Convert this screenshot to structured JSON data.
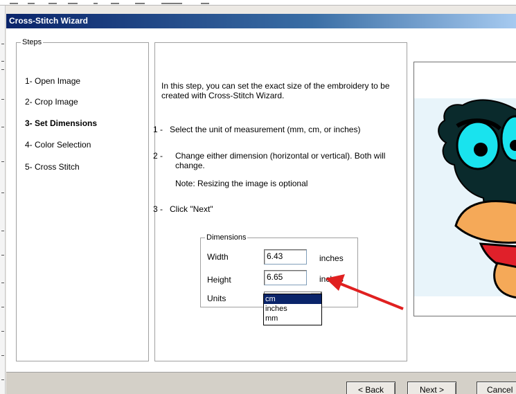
{
  "window": {
    "title": "Cross-Stitch Wizard"
  },
  "steps": {
    "label": "Steps",
    "items": [
      {
        "label": "1- Open Image",
        "active": false
      },
      {
        "label": "2- Crop Image",
        "active": false
      },
      {
        "label": "3- Set Dimensions",
        "active": true
      },
      {
        "label": "4- Color Selection",
        "active": false
      },
      {
        "label": "5- Cross Stitch",
        "active": false
      }
    ]
  },
  "instructions": {
    "intro": "In this step, you can set the exact size of the embroidery to be created with Cross-Stitch Wizard.",
    "step1": "1 -   Select the unit of measurement (mm, cm, or inches)",
    "step2_num": "2 -",
    "step2": "Change either dimension (horizontal or vertical). Both will change.",
    "note": "Note: Resizing the image is optional",
    "step3": "3 -   Click \"Next\""
  },
  "dimensions": {
    "label": "Dimensions",
    "width_label": "Width",
    "width_value": "6.43",
    "width_unit": "inches",
    "height_label": "Height",
    "height_value": "6.65",
    "height_unit": "inches",
    "units_label": "Units",
    "units_selected": "inches",
    "units_options": [
      "cm",
      "inches",
      "mm"
    ],
    "highlighted_option": "cm"
  },
  "buttons": {
    "back": "< Back",
    "next": "Next >",
    "cancel": "Cancel"
  },
  "colors": {
    "title_gradient_start": "#0a246a",
    "selection": "#0a246a",
    "arrow": "#e02020",
    "eye": "#19e3ee",
    "beak": "#f5a958"
  }
}
